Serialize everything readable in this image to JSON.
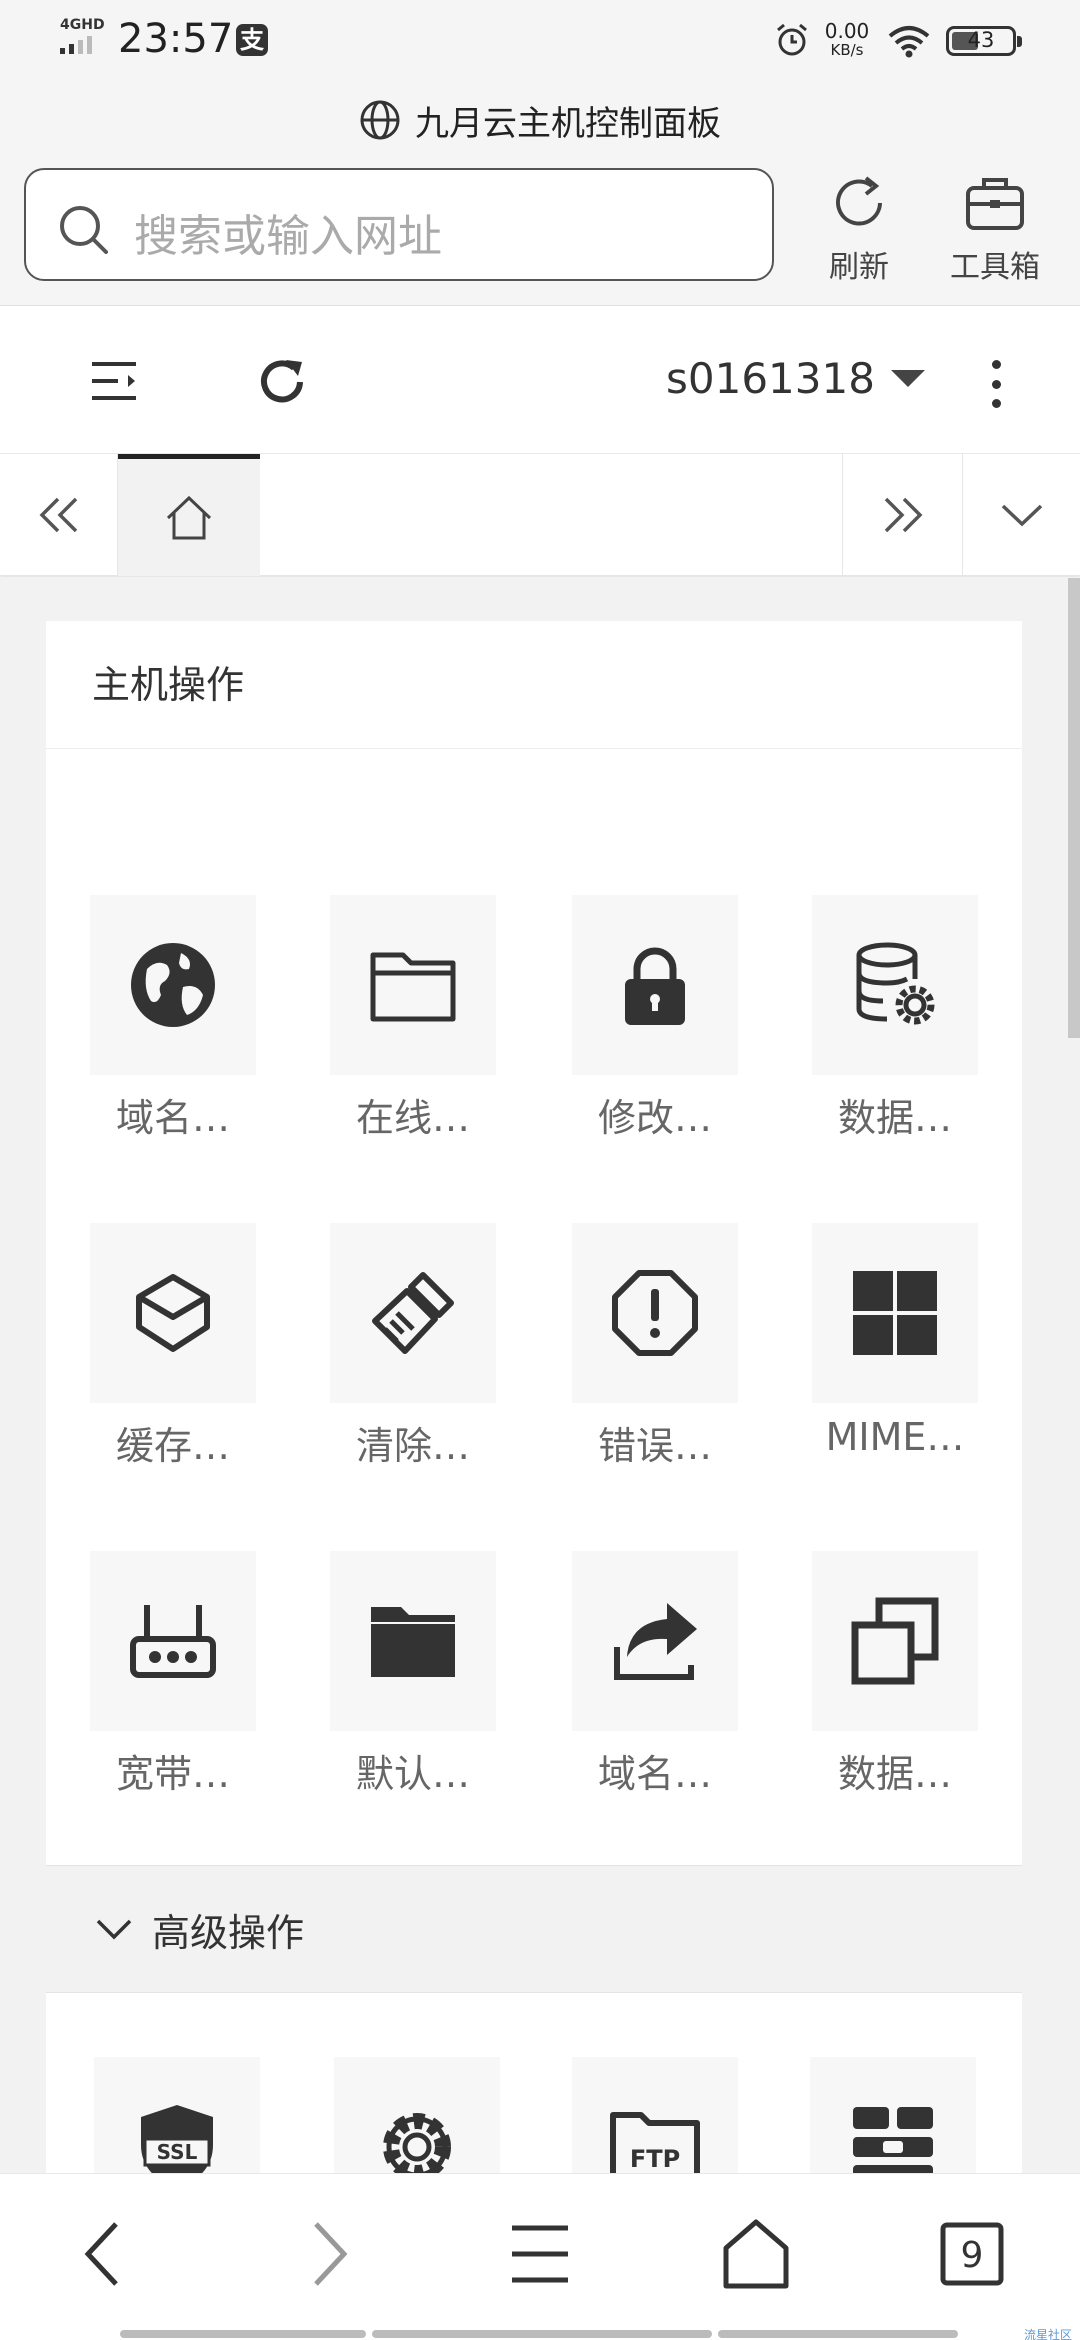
{
  "status_bar": {
    "network": "4GHD",
    "time": "23:57",
    "alipay_glyph": "支",
    "speed_value": "0.00",
    "speed_unit": "KB/s",
    "battery": "43"
  },
  "browser": {
    "page_title": "九月云主机控制面板",
    "search_placeholder": "搜索或输入网址",
    "refresh_label": "刷新",
    "toolbox_label": "工具箱"
  },
  "app": {
    "account": "s0161318"
  },
  "panel": {
    "title": "主机操作",
    "items": [
      {
        "label": "域名…",
        "icon": "globe-icon"
      },
      {
        "label": "在线…",
        "icon": "folder-outline-icon"
      },
      {
        "label": "修改…",
        "icon": "lock-icon"
      },
      {
        "label": "数据…",
        "icon": "database-gear-icon"
      },
      {
        "label": "缓存…",
        "icon": "layers-icon"
      },
      {
        "label": "清除…",
        "icon": "brush-icon"
      },
      {
        "label": "错误…",
        "icon": "error-octagon-icon"
      },
      {
        "label": "MIME…",
        "icon": "windows-grid-icon"
      },
      {
        "label": "宽带…",
        "icon": "router-icon"
      },
      {
        "label": "默认…",
        "icon": "folder-solid-icon"
      },
      {
        "label": "域名…",
        "icon": "share-forward-icon"
      },
      {
        "label": "数据…",
        "icon": "copy-icon"
      }
    ],
    "advanced_title": "高级操作",
    "advanced_items": [
      {
        "icon": "ssl-shield-icon",
        "text": "SSL"
      },
      {
        "icon": "gear-icon"
      },
      {
        "icon": "ftp-folder-icon",
        "text": "FTP"
      },
      {
        "icon": "server-grid-icon"
      }
    ]
  },
  "bottom_nav": {
    "tab_count": "9"
  },
  "watermark": "流星社区"
}
